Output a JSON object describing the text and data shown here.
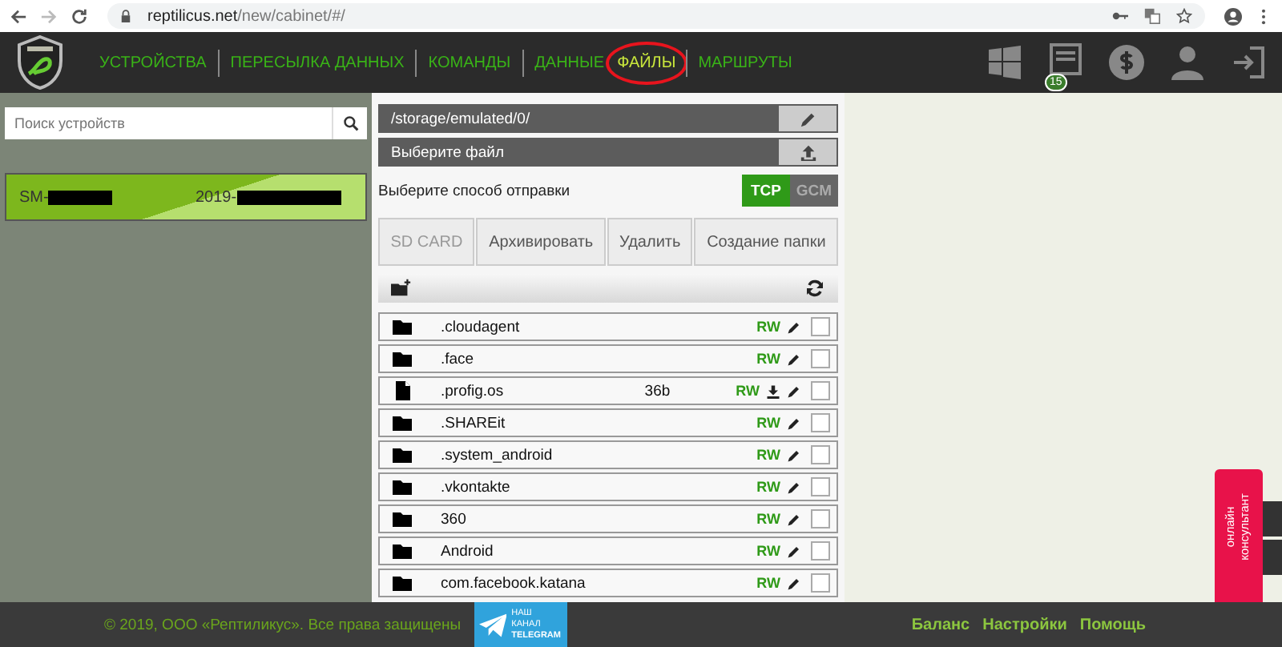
{
  "browser": {
    "url_host": "reptilicus.net",
    "url_path": "/new/cabinet/#/"
  },
  "header": {
    "nav": [
      {
        "label": "УСТРОЙСТВА",
        "selected": false,
        "circled": false
      },
      {
        "label": "ПЕРЕСЫЛКА ДАННЫХ",
        "selected": false,
        "circled": false
      },
      {
        "label": "КОМАНДЫ",
        "selected": false,
        "circled": false
      },
      {
        "label": "ДАННЫЕ",
        "selected": false,
        "circled": false
      },
      {
        "label": "ФАЙЛЫ",
        "selected": true,
        "circled": true
      },
      {
        "label": "МАРШРУТЫ",
        "selected": false,
        "circled": false
      }
    ],
    "calendar_badge": "15"
  },
  "sidebar": {
    "search": {
      "placeholder": "Поиск устройств"
    },
    "devices": [
      {
        "model": "SM-",
        "date": "2019-",
        "selected": true
      }
    ]
  },
  "files": {
    "path": "/storage/emulated/0/",
    "file_picker": "Выберите файл",
    "send_method_label": "Выберите способ отправки",
    "send_methods": [
      {
        "label": "TCP",
        "selected": true
      },
      {
        "label": "GCM",
        "selected": false
      }
    ],
    "actions": [
      {
        "label": "SD CARD",
        "disabled": true
      },
      {
        "label": "Архивировать",
        "disabled": false
      },
      {
        "label": "Удалить",
        "disabled": false
      },
      {
        "label": "Создание папки",
        "disabled": false
      }
    ],
    "items": [
      {
        "kind": "folder",
        "name": ".cloudagent",
        "permissions": "RW",
        "checked": false
      },
      {
        "kind": "folder",
        "name": ".face",
        "permissions": "RW",
        "checked": false
      },
      {
        "kind": "file",
        "name": ".profig.os",
        "size": "36b",
        "permissions": "RW",
        "checked": false
      },
      {
        "kind": "folder",
        "name": ".SHAREit",
        "permissions": "RW",
        "checked": false
      },
      {
        "kind": "folder",
        "name": ".system_android",
        "permissions": "RW",
        "checked": false
      },
      {
        "kind": "folder",
        "name": ".vkontakte",
        "permissions": "RW",
        "checked": false
      },
      {
        "kind": "folder",
        "name": "360",
        "permissions": "RW",
        "checked": false
      },
      {
        "kind": "folder",
        "name": "Android",
        "permissions": "RW",
        "checked": false
      },
      {
        "kind": "folder",
        "name": "com.facebook.katana",
        "permissions": "RW",
        "checked": false
      }
    ]
  },
  "footer": {
    "copyright": "© 2019, ООО «Рептиликус». Все права защищены",
    "telegram": {
      "line1": "НАШ КАНАЛ",
      "line2": "TELEGRAM"
    },
    "links": [
      "Баланс",
      "Настройки",
      "Помощь"
    ]
  },
  "chat_widget": {
    "label": "онлайн консультант"
  }
}
